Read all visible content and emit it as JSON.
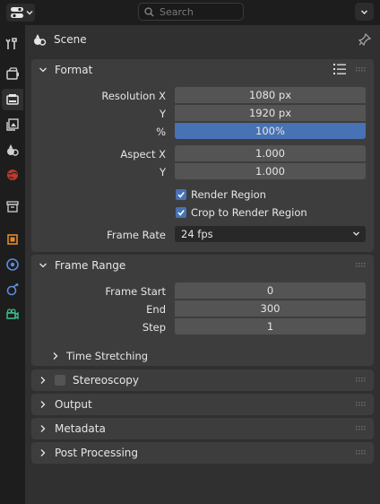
{
  "topbar": {
    "editor_type_icon": "properties-editor-icon",
    "search_placeholder": "Search"
  },
  "sidebar": {
    "tabs": [
      {
        "name": "tool",
        "icon": "tool-icon"
      },
      {
        "name": "render",
        "icon": "render-icon"
      },
      {
        "name": "output",
        "icon": "output-icon",
        "active": true
      },
      {
        "name": "view-layer",
        "icon": "view-layer-icon"
      },
      {
        "name": "scene",
        "icon": "scene-icon"
      },
      {
        "name": "world",
        "icon": "world-icon"
      },
      {
        "name": "collection",
        "icon": "collection-icon"
      },
      {
        "name": "object",
        "icon": "object-icon"
      },
      {
        "name": "modifiers",
        "icon": "modifiers-icon"
      },
      {
        "name": "physics",
        "icon": "physics-icon"
      },
      {
        "name": "camera-data",
        "icon": "camera-data-icon"
      }
    ]
  },
  "context": {
    "label": "Scene"
  },
  "format": {
    "title": "Format",
    "resolution_x_label": "Resolution X",
    "resolution_x": "1080 px",
    "resolution_y_label": "Y",
    "resolution_y": "1920 px",
    "percent_label": "%",
    "percent": "100%",
    "aspect_x_label": "Aspect X",
    "aspect_x": "1.000",
    "aspect_y_label": "Y",
    "aspect_y": "1.000",
    "render_region": "Render Region",
    "crop_region": "Crop to Render Region",
    "frame_rate_label": "Frame Rate",
    "frame_rate": "24 fps"
  },
  "frame_range": {
    "title": "Frame Range",
    "start_label": "Frame Start",
    "start": "0",
    "end_label": "End",
    "end": "300",
    "step_label": "Step",
    "step": "1",
    "time_stretching": "Time Stretching"
  },
  "panels": {
    "stereoscopy": "Stereoscopy",
    "output": "Output",
    "metadata": "Metadata",
    "post_processing": "Post Processing"
  },
  "colors": {
    "accent": "#4772b3",
    "panel": "#3d3d3d",
    "field": "#545454"
  }
}
